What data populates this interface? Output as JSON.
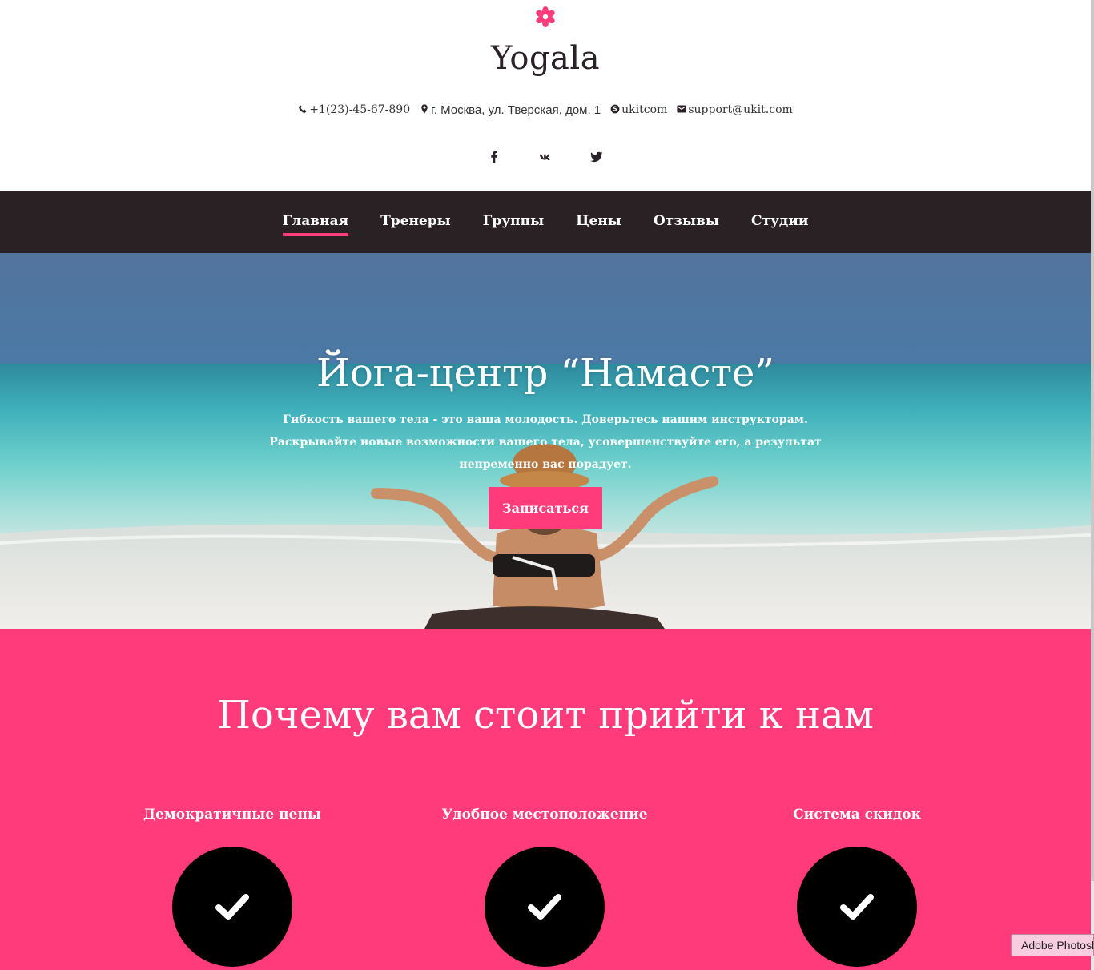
{
  "brand": {
    "title": "Yogala",
    "accent_color": "#ff3b7b",
    "logo_icon": "flower-icon"
  },
  "contacts": {
    "phone": "+1(23)-45-67-890",
    "address": "г. Москва, ул. Тверская, дом. 1",
    "skype": "ukitcom",
    "email": "support@ukit.com"
  },
  "socials": [
    "facebook-icon",
    "vk-icon",
    "twitter-icon"
  ],
  "nav": {
    "items": [
      {
        "label": "Главная",
        "active": true
      },
      {
        "label": "Тренеры"
      },
      {
        "label": "Группы"
      },
      {
        "label": "Цены"
      },
      {
        "label": "Отзывы"
      },
      {
        "label": "Студии"
      }
    ]
  },
  "hero": {
    "title": "Йога-центр “Намасте”",
    "text": "Гибкость вашего тела - это ваша молодость. Доверьтесь нашим инструкторам. Раскрывайте новые возможности вашего тела, усовершенствуйте его, а результат непременно вас порадует.",
    "cta_label": "Записаться"
  },
  "why": {
    "title": "Почему вам стоит прийти к нам",
    "features": [
      {
        "label": "Демократичные цены",
        "icon": "check-icon"
      },
      {
        "label": "Удобное местоположение",
        "icon": "check-icon"
      },
      {
        "label": "Система скидок",
        "icon": "check-icon"
      }
    ]
  },
  "tooltip": {
    "text": "Adobe Photoshop"
  }
}
